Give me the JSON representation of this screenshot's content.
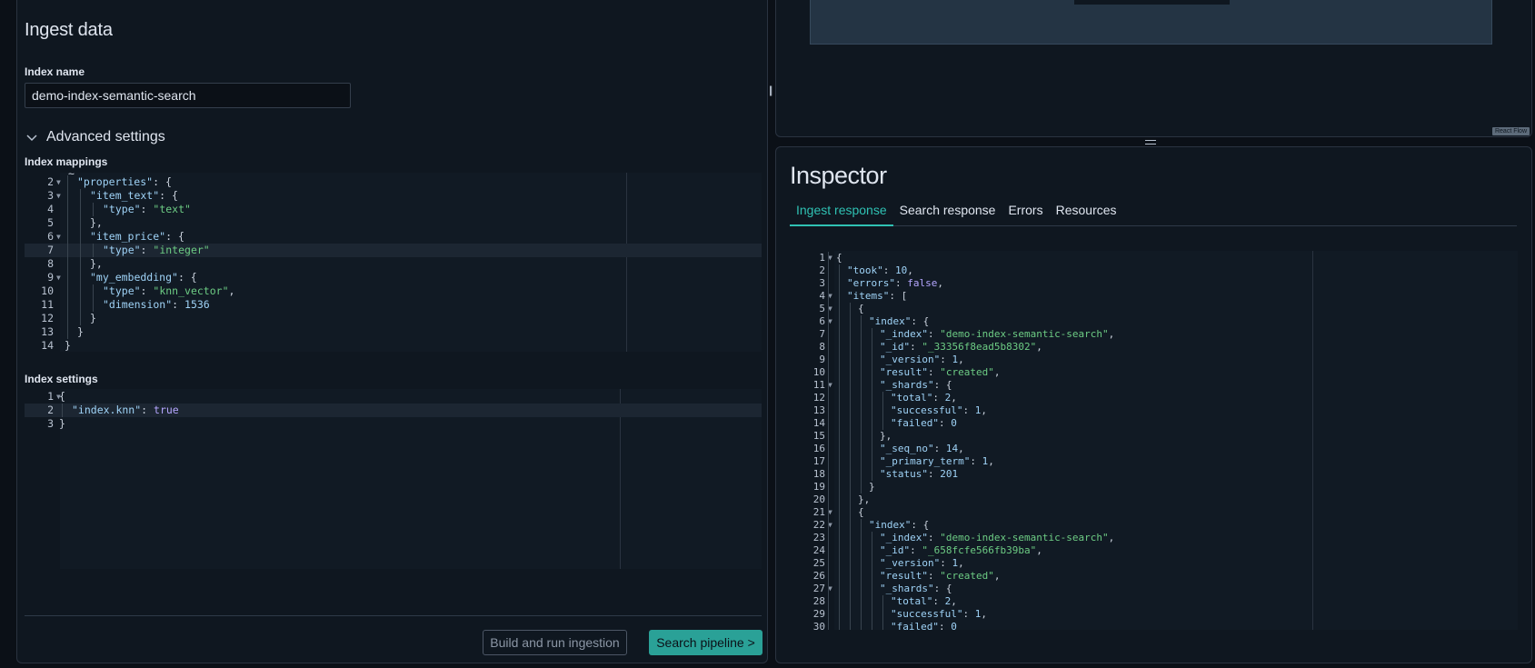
{
  "left": {
    "title": "Ingest data",
    "index_name_label": "Index name",
    "index_name_value": "demo-index-semantic-search",
    "advanced_label": "Advanced settings",
    "mappings_label": "Index mappings",
    "settings_label": "Index settings",
    "build_button": "Build and run ingestion",
    "next_button": "Search pipeline >"
  },
  "flow": {
    "attribution": "React Flow"
  },
  "inspector": {
    "title": "Inspector",
    "tabs": [
      "Ingest response",
      "Search response",
      "Errors",
      "Resources"
    ],
    "active_tab": "Ingest response"
  },
  "mappings_lines": [
    {
      "n": "2",
      "fold": true,
      "depth": 0,
      "html": "<span class='k'>\"properties\"</span><span class='p'>: {</span>"
    },
    {
      "n": "3",
      "fold": true,
      "depth": 1,
      "html": "<span class='k'>\"item_text\"</span><span class='p'>: {</span>"
    },
    {
      "n": "4",
      "fold": false,
      "depth": 2,
      "html": "<span class='k'>\"type\"</span><span class='p'>: </span><span class='s'>\"text\"</span>"
    },
    {
      "n": "5",
      "fold": false,
      "depth": 1,
      "html": "<span class='p'>},</span>"
    },
    {
      "n": "6",
      "fold": true,
      "depth": 1,
      "html": "<span class='k'>\"item_price\"</span><span class='p'>: {</span>"
    },
    {
      "n": "7",
      "fold": false,
      "depth": 2,
      "active": true,
      "html": "<span class='k'>\"type\"</span><span class='p'>: </span><span class='s'>\"integer\"</span>"
    },
    {
      "n": "8",
      "fold": false,
      "depth": 1,
      "html": "<span class='p'>},</span>"
    },
    {
      "n": "9",
      "fold": true,
      "depth": 1,
      "html": "<span class='k'>\"my_embedding\"</span><span class='p'>: {</span>"
    },
    {
      "n": "10",
      "fold": false,
      "depth": 2,
      "html": "<span class='k'>\"type\"</span><span class='p'>: </span><span class='s'>\"knn_vector\"</span><span class='p'>,</span>"
    },
    {
      "n": "11",
      "fold": false,
      "depth": 2,
      "html": "<span class='k'>\"dimension\"</span><span class='p'>: </span><span class='n'>1536</span>"
    },
    {
      "n": "12",
      "fold": false,
      "depth": 1,
      "html": "<span class='p'>}</span>"
    },
    {
      "n": "13",
      "fold": false,
      "depth": 0,
      "html": "<span class='p'>}</span>"
    },
    {
      "n": "14",
      "fold": false,
      "depth": -1,
      "html": "<span class='p'>}</span>"
    }
  ],
  "settings_lines": [
    {
      "n": "1",
      "fold": true,
      "depth": -1,
      "html": "<span class='p'>{</span>"
    },
    {
      "n": "2",
      "fold": false,
      "depth": 0,
      "active": true,
      "html": "<span class='k'>\"index.knn\"</span><span class='p'>: </span><span class='b'>true</span>"
    },
    {
      "n": "3",
      "fold": false,
      "depth": -1,
      "html": "<span class='p'>}</span>"
    }
  ],
  "response_lines": [
    {
      "n": "1",
      "fold": true,
      "depth": 0,
      "html": "<span class='p'>{</span>"
    },
    {
      "n": "2",
      "fold": false,
      "depth": 1,
      "html": "<span class='k'>\"took\"</span><span class='p'>: </span><span class='n'>10</span><span class='p'>,</span>"
    },
    {
      "n": "3",
      "fold": false,
      "depth": 1,
      "html": "<span class='k'>\"errors\"</span><span class='p'>: </span><span class='b'>false</span><span class='p'>,</span>"
    },
    {
      "n": "4",
      "fold": true,
      "depth": 1,
      "html": "<span class='k'>\"items\"</span><span class='p'>: [</span>"
    },
    {
      "n": "5",
      "fold": true,
      "depth": 2,
      "html": "<span class='p'>{</span>"
    },
    {
      "n": "6",
      "fold": true,
      "depth": 3,
      "html": "<span class='k'>\"index\"</span><span class='p'>: {</span>"
    },
    {
      "n": "7",
      "fold": false,
      "depth": 4,
      "html": "<span class='k'>\"_index\"</span><span class='p'>: </span><span class='s'>\"demo-index-semantic-search\"</span><span class='p'>,</span>"
    },
    {
      "n": "8",
      "fold": false,
      "depth": 4,
      "html": "<span class='k'>\"_id\"</span><span class='p'>: </span><span class='s'>\"_33356f8ead5b8302\"</span><span class='p'>,</span>"
    },
    {
      "n": "9",
      "fold": false,
      "depth": 4,
      "html": "<span class='k'>\"_version\"</span><span class='p'>: </span><span class='n'>1</span><span class='p'>,</span>"
    },
    {
      "n": "10",
      "fold": false,
      "depth": 4,
      "html": "<span class='k'>\"result\"</span><span class='p'>: </span><span class='s'>\"created\"</span><span class='p'>,</span>"
    },
    {
      "n": "11",
      "fold": true,
      "depth": 4,
      "html": "<span class='k'>\"_shards\"</span><span class='p'>: {</span>"
    },
    {
      "n": "12",
      "fold": false,
      "depth": 5,
      "html": "<span class='k'>\"total\"</span><span class='p'>: </span><span class='n'>2</span><span class='p'>,</span>"
    },
    {
      "n": "13",
      "fold": false,
      "depth": 5,
      "html": "<span class='k'>\"successful\"</span><span class='p'>: </span><span class='n'>1</span><span class='p'>,</span>"
    },
    {
      "n": "14",
      "fold": false,
      "depth": 5,
      "html": "<span class='k'>\"failed\"</span><span class='p'>: </span><span class='n'>0</span>"
    },
    {
      "n": "15",
      "fold": false,
      "depth": 4,
      "html": "<span class='p'>},</span>"
    },
    {
      "n": "16",
      "fold": false,
      "depth": 4,
      "html": "<span class='k'>\"_seq_no\"</span><span class='p'>: </span><span class='n'>14</span><span class='p'>,</span>"
    },
    {
      "n": "17",
      "fold": false,
      "depth": 4,
      "html": "<span class='k'>\"_primary_term\"</span><span class='p'>: </span><span class='n'>1</span><span class='p'>,</span>"
    },
    {
      "n": "18",
      "fold": false,
      "depth": 4,
      "html": "<span class='k'>\"status\"</span><span class='p'>: </span><span class='n'>201</span>"
    },
    {
      "n": "19",
      "fold": false,
      "depth": 3,
      "html": "<span class='p'>}</span>"
    },
    {
      "n": "20",
      "fold": false,
      "depth": 2,
      "html": "<span class='p'>},</span>"
    },
    {
      "n": "21",
      "fold": true,
      "depth": 2,
      "html": "<span class='p'>{</span>"
    },
    {
      "n": "22",
      "fold": true,
      "depth": 3,
      "html": "<span class='k'>\"index\"</span><span class='p'>: {</span>"
    },
    {
      "n": "23",
      "fold": false,
      "depth": 4,
      "html": "<span class='k'>\"_index\"</span><span class='p'>: </span><span class='s'>\"demo-index-semantic-search\"</span><span class='p'>,</span>"
    },
    {
      "n": "24",
      "fold": false,
      "depth": 4,
      "html": "<span class='k'>\"_id\"</span><span class='p'>: </span><span class='s'>\"_658fcfe566fb39ba\"</span><span class='p'>,</span>"
    },
    {
      "n": "25",
      "fold": false,
      "depth": 4,
      "html": "<span class='k'>\"_version\"</span><span class='p'>: </span><span class='n'>1</span><span class='p'>,</span>"
    },
    {
      "n": "26",
      "fold": false,
      "depth": 4,
      "html": "<span class='k'>\"result\"</span><span class='p'>: </span><span class='s'>\"created\"</span><span class='p'>,</span>"
    },
    {
      "n": "27",
      "fold": true,
      "depth": 4,
      "html": "<span class='k'>\"_shards\"</span><span class='p'>: {</span>"
    },
    {
      "n": "28",
      "fold": false,
      "depth": 5,
      "html": "<span class='k'>\"total\"</span><span class='p'>: </span><span class='n'>2</span><span class='p'>,</span>"
    },
    {
      "n": "29",
      "fold": false,
      "depth": 5,
      "html": "<span class='k'>\"successful\"</span><span class='p'>: </span><span class='n'>1</span><span class='p'>,</span>"
    },
    {
      "n": "30",
      "fold": false,
      "depth": 5,
      "html": "<span class='k'>\"failed\"</span><span class='p'>: </span><span class='n'>0</span>"
    }
  ]
}
